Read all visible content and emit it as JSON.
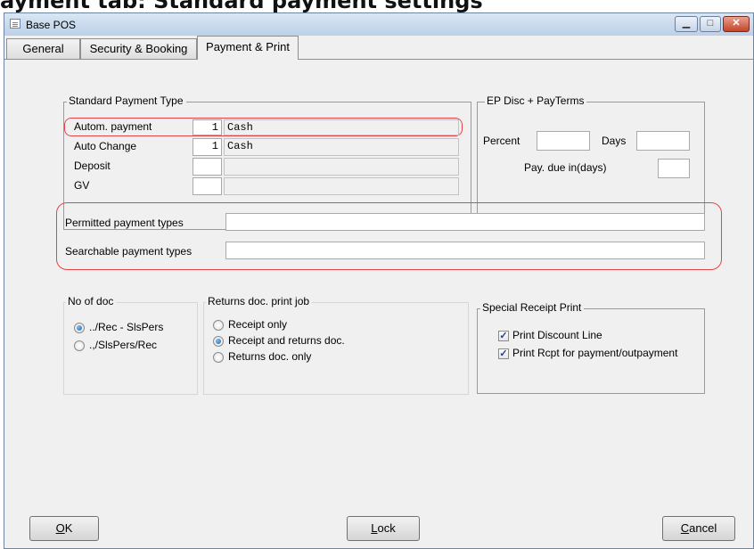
{
  "top_caption": "ayment tab: Standard payment settings",
  "window": {
    "title": "Base POS",
    "minimize_glyph": "▁",
    "maximize_glyph": "□",
    "close_glyph": "✕",
    "app_icon": "window-icon"
  },
  "tabs": [
    {
      "label": "General"
    },
    {
      "label": "Security & Booking"
    },
    {
      "label": "Payment & Print",
      "active": true
    }
  ],
  "standard_payment": {
    "legend": "Standard Payment Type",
    "rows": [
      {
        "label": "Autom. payment",
        "code": "1",
        "name": "Cash"
      },
      {
        "label": "Auto Change",
        "code": "1",
        "name": "Cash"
      },
      {
        "label": "Deposit",
        "code": "",
        "name": ""
      },
      {
        "label": "GV",
        "code": "",
        "name": ""
      }
    ]
  },
  "ep_disc": {
    "legend": "EP Disc + PayTerms",
    "percent_label": "Percent",
    "percent_value": "",
    "days_label": "Days",
    "days_value": "",
    "pay_due_label": "Pay. due in(days)",
    "pay_due_value": ""
  },
  "payment_types": {
    "permitted_label": "Permitted payment types",
    "permitted_value": "",
    "searchable_label": "Searchable payment types",
    "searchable_value": ""
  },
  "no_of_doc": {
    "legend": "No of doc",
    "options": [
      {
        "label": "../Rec - SlsPers",
        "selected": true
      },
      {
        "label": ".,/SlsPers/Rec",
        "selected": false
      }
    ]
  },
  "returns_doc": {
    "legend": "Returns doc. print job",
    "options": [
      {
        "label": "Receipt only",
        "selected": false
      },
      {
        "label": "Receipt and returns doc.",
        "selected": true
      },
      {
        "label": "Returns doc. only",
        "selected": false
      }
    ]
  },
  "special_receipt": {
    "legend": "Special Receipt Print",
    "options": [
      {
        "label": "Print Discount Line",
        "checked": true
      },
      {
        "label": "Print Rcpt for payment/outpayment",
        "checked": true
      }
    ]
  },
  "buttons": {
    "ok_mnemonic": "O",
    "ok_rest": "K",
    "lock_mnemonic": "L",
    "lock_rest": "ock",
    "cancel_mnemonic": "C",
    "cancel_rest": "ancel"
  },
  "colors": {
    "highlight": "#e2454a",
    "window_frame": "#c6d8ec",
    "dialog_bg": "#f0f0f0"
  },
  "check_glyph": "✓"
}
